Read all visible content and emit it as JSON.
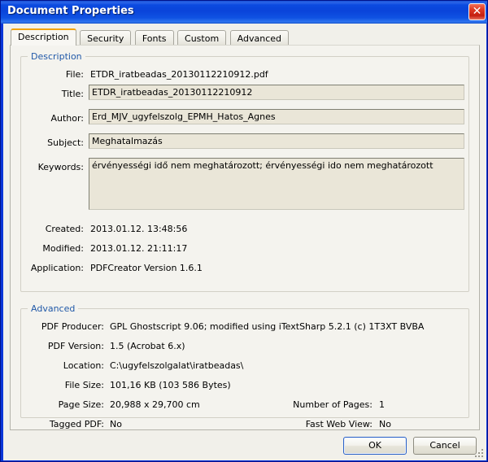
{
  "window": {
    "title": "Document Properties",
    "close_icon": "close-icon",
    "close_glyph": "✕",
    "titlebar_color": "#0a44da",
    "accent_color": "#f0a30a",
    "legend_color": "#2159a8",
    "field_bg": "#eae6d8"
  },
  "tabs": [
    {
      "label": "Description",
      "active": true
    },
    {
      "label": "Security",
      "active": false
    },
    {
      "label": "Fonts",
      "active": false
    },
    {
      "label": "Custom",
      "active": false
    },
    {
      "label": "Advanced",
      "active": false
    }
  ],
  "description": {
    "legend": "Description",
    "file": {
      "label": "File:",
      "value": "ETDR_iratbeadas_20130112210912.pdf"
    },
    "title": {
      "label": "Title:",
      "value": "ETDR_iratbeadas_20130112210912",
      "placeholder": ""
    },
    "author": {
      "label": "Author:",
      "value": "Erd_MJV_ugyfelszolg_EPMH_Hatos_Agnes",
      "placeholder": ""
    },
    "subject": {
      "label": "Subject:",
      "value": "Meghatalmazás",
      "placeholder": ""
    },
    "keywords": {
      "label": "Keywords:",
      "value": "érvényességi idő nem meghatározott; érvényességi ido nem meghatározott",
      "placeholder": ""
    },
    "created": {
      "label": "Created:",
      "value": "2013.01.12. 13:48:56"
    },
    "modified": {
      "label": "Modified:",
      "value": "2013.01.12. 21:11:17"
    },
    "application": {
      "label": "Application:",
      "value": "PDFCreator Version 1.6.1"
    }
  },
  "advanced": {
    "legend": "Advanced",
    "pdf_producer": {
      "label": "PDF Producer:",
      "value": "GPL Ghostscript 9.06; modified using iTextSharp 5.2.1 (c) 1T3XT BVBA"
    },
    "pdf_version": {
      "label": "PDF Version:",
      "value": "1.5 (Acrobat 6.x)"
    },
    "location": {
      "label": "Location:",
      "value": "C:\\ugyfelszolgalat\\iratbeadas\\"
    },
    "file_size": {
      "label": "File Size:",
      "value": "101,16 KB (103 586 Bytes)"
    },
    "page_size": {
      "label": "Page Size:",
      "value": "20,988 x 29,700 cm"
    },
    "number_of_pages": {
      "label": "Number of Pages:",
      "value": "1"
    },
    "tagged_pdf": {
      "label": "Tagged PDF:",
      "value": "No"
    },
    "fast_web_view": {
      "label": "Fast Web View:",
      "value": "No"
    }
  },
  "footer": {
    "ok_label": "OK",
    "cancel_label": "Cancel"
  }
}
